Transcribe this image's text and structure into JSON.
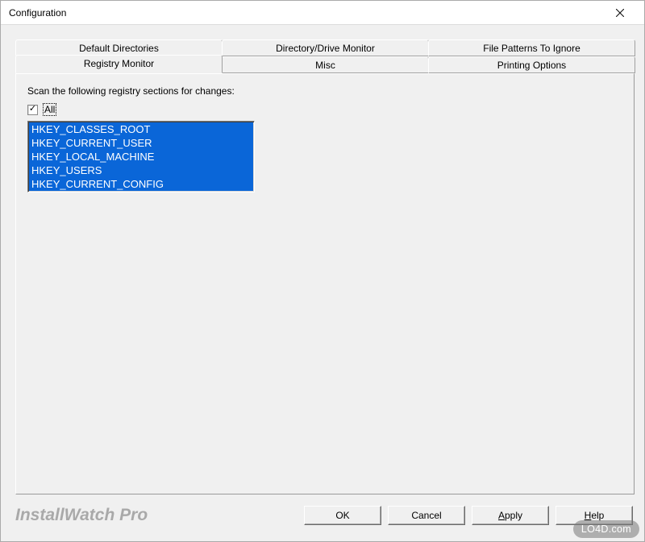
{
  "window": {
    "title": "Configuration"
  },
  "tabs": {
    "row_back": [
      {
        "label": "Default Directories"
      },
      {
        "label": "Directory/Drive Monitor"
      },
      {
        "label": "File Patterns To Ignore"
      }
    ],
    "row_front": [
      {
        "label": "Registry Monitor",
        "active": true
      },
      {
        "label": "Misc"
      },
      {
        "label": "Printing Options"
      }
    ]
  },
  "panel": {
    "scan_label": "Scan the following registry sections for changes:",
    "all_checked": true,
    "all_label": "All",
    "items": [
      "HKEY_CLASSES_ROOT",
      "HKEY_CURRENT_USER",
      "HKEY_LOCAL_MACHINE",
      "HKEY_USERS",
      "HKEY_CURRENT_CONFIG"
    ]
  },
  "footer": {
    "brand": "InstallWatch Pro",
    "buttons": {
      "ok": "OK",
      "cancel": "Cancel",
      "apply_pre": "A",
      "apply_rest": "pply",
      "help_pre": "H",
      "help_rest": "elp"
    }
  },
  "watermark": "LO4D.com"
}
